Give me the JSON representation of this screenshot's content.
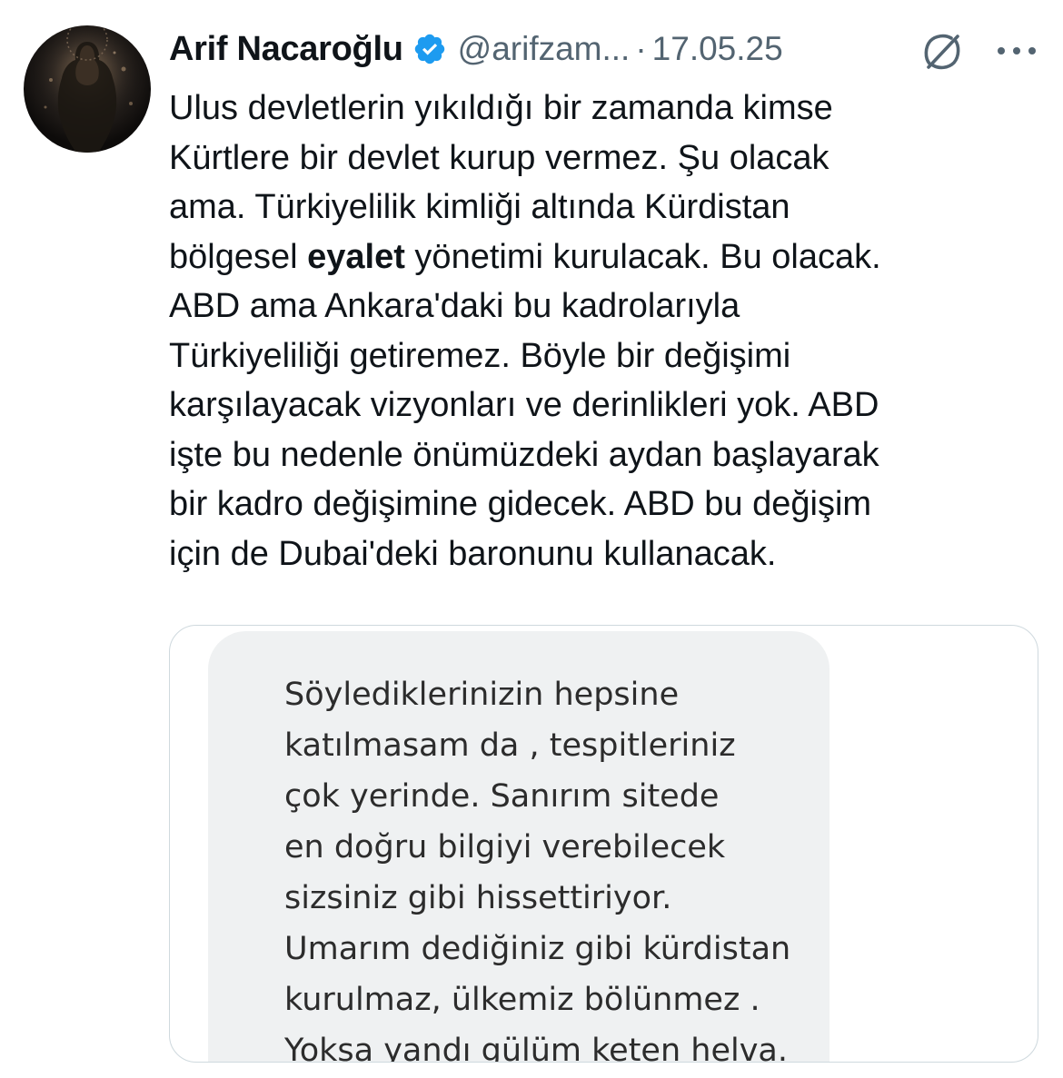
{
  "author": {
    "display_name": "Arif Nacaroğlu",
    "handle": "@arifzam...",
    "verified_icon": "verified-badge-icon",
    "verified_color": "#1d9bf0"
  },
  "meta": {
    "separator": "·",
    "date": "17.05.25"
  },
  "actions": {
    "grok_icon": "grok-icon",
    "more_icon": "more-options-icon"
  },
  "tweet_text": {
    "lines": [
      {
        "text": "Ulus devletlerin yıkıldığı bir zamanda kimse"
      },
      {
        "text": "Kürtlere bir devlet kurup vermez. Şu olacak"
      },
      {
        "text": "ama. Türkiyelilik kimliği altında Kürdistan"
      },
      {
        "before": "bölgesel ",
        "bold": "eyalet",
        "after": " yönetimi kurulacak. Bu olacak."
      },
      {
        "text": "ABD ama Ankara'daki bu kadrolarıyla"
      },
      {
        "text": "Türkiyeliliği getiremez. Böyle bir değişimi"
      },
      {
        "text": "karşılayacak vizyonları ve derinlikleri yok. ABD"
      },
      {
        "text": "işte bu nedenle önümüzdeki aydan başlayarak"
      },
      {
        "text": "bir kadro değişimine gidecek. ABD bu değişim"
      },
      {
        "text": "için de Dubai'deki baronunu kullanacak."
      }
    ]
  },
  "media": {
    "lines": [
      "Söylediklerinizin hepsine",
      "katılmasam da , tespitleriniz",
      "çok yerinde. Sanırım sitede",
      "en doğru bilgiyi verebilecek",
      "sizsiniz gibi hissettiriyor.",
      "Umarım dediğiniz gibi kürdistan",
      "kurulmaz, ülkemiz bölünmez .",
      "Yoksa yandı gülüm keten helva."
    ]
  },
  "colors": {
    "text_primary": "#0f1419",
    "text_secondary": "#536471",
    "border": "#cfd9de",
    "media_bg": "#eff1f2"
  }
}
